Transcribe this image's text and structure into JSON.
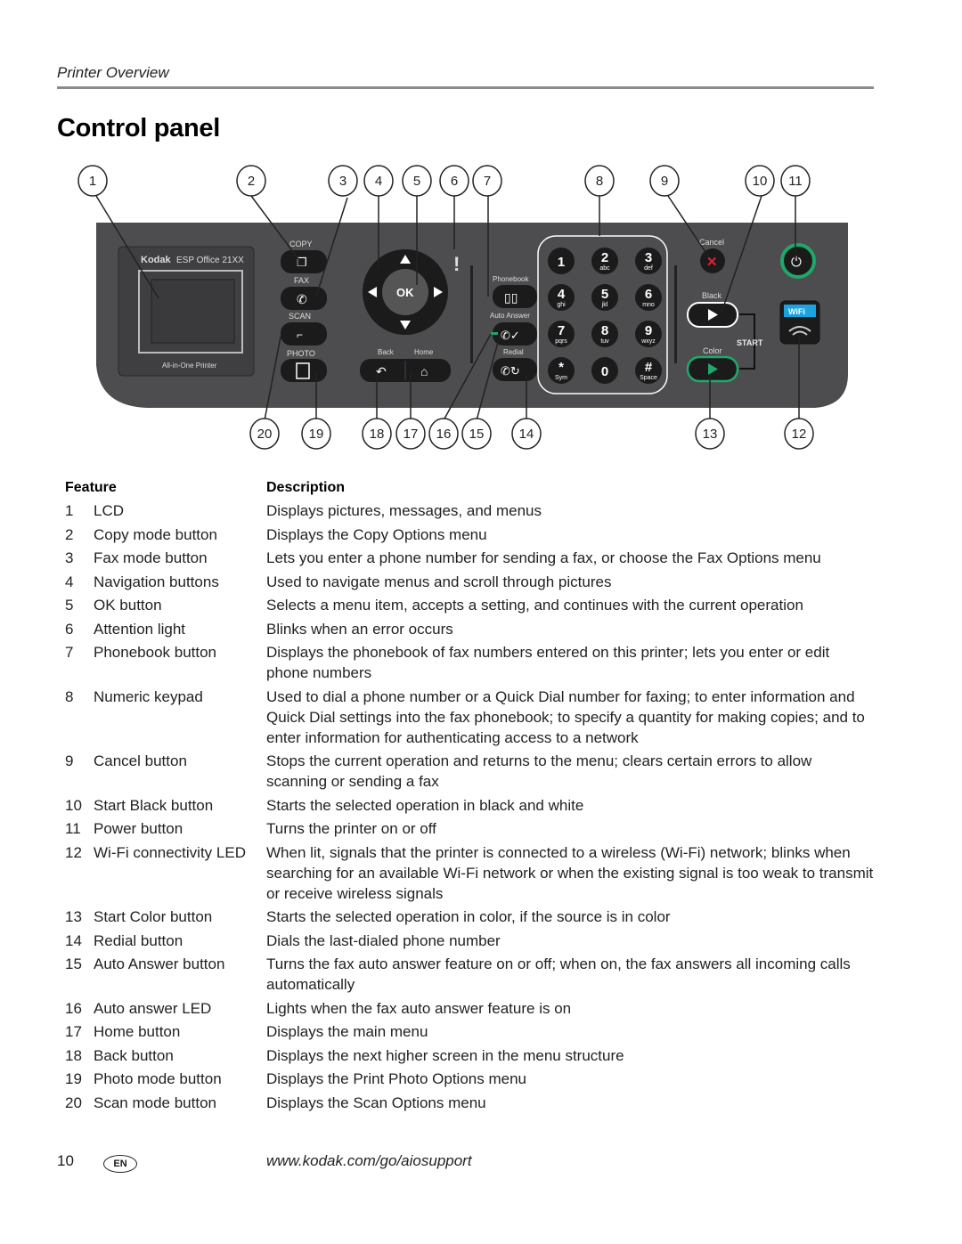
{
  "header": {
    "section": "Printer Overview",
    "title": "Control panel"
  },
  "diagram": {
    "brand": "Kodak",
    "model": "ESP Office 21XX",
    "subtitle": "All-in-One Printer",
    "labels": {
      "copy": "COPY",
      "fax": "FAX",
      "scan": "SCAN",
      "photo": "PHOTO",
      "ok": "OK",
      "back": "Back",
      "home": "Home",
      "phonebook": "Phonebook",
      "auto_answer": "Auto Answer",
      "redial": "Redial",
      "cancel": "Cancel",
      "black": "Black",
      "color": "Color",
      "start": "START",
      "wifi": "WiFi",
      "attention": "!"
    },
    "keypad": [
      {
        "digit": "1",
        "sub": ""
      },
      {
        "digit": "2",
        "sub": "abc"
      },
      {
        "digit": "3",
        "sub": "def"
      },
      {
        "digit": "4",
        "sub": "ghi"
      },
      {
        "digit": "5",
        "sub": "jkl"
      },
      {
        "digit": "6",
        "sub": "mno"
      },
      {
        "digit": "7",
        "sub": "pqrs"
      },
      {
        "digit": "8",
        "sub": "tuv"
      },
      {
        "digit": "9",
        "sub": "wxyz"
      },
      {
        "digit": "*",
        "sub": "Sym"
      },
      {
        "digit": "0",
        "sub": ""
      },
      {
        "digit": "#",
        "sub": "Space"
      }
    ],
    "callouts_top": [
      "1",
      "2",
      "3",
      "4",
      "5",
      "6",
      "7",
      "8",
      "9",
      "10",
      "11"
    ],
    "callouts_bottom": [
      "20",
      "19",
      "18",
      "17",
      "16",
      "15",
      "14",
      "13",
      "12"
    ],
    "colors": {
      "panel": "#4d4d4f",
      "button": "#1b1b1b",
      "accent_green": "#1fa86a",
      "cancel_red": "#e0203a",
      "wifi_blue": "#1aa3e0"
    }
  },
  "table": {
    "headers": {
      "feature": "Feature",
      "description": "Description"
    },
    "rows": [
      {
        "num": "1",
        "feature": "LCD",
        "description": "Displays pictures, messages, and menus"
      },
      {
        "num": "2",
        "feature": "Copy mode button",
        "description": "Displays the Copy Options menu"
      },
      {
        "num": "3",
        "feature": "Fax mode button",
        "description": "Lets you enter a phone number for sending a fax, or choose the Fax Options menu"
      },
      {
        "num": "4",
        "feature": "Navigation buttons",
        "description": "Used to navigate menus and scroll through pictures"
      },
      {
        "num": "5",
        "feature": "OK button",
        "description": "Selects a menu item, accepts a setting, and continues with the current operation"
      },
      {
        "num": "6",
        "feature": "Attention light",
        "description": "Blinks when an error occurs"
      },
      {
        "num": "7",
        "feature": "Phonebook button",
        "description": "Displays the phonebook of fax numbers entered on this printer; lets you enter or edit phone numbers"
      },
      {
        "num": "8",
        "feature": "Numeric keypad",
        "description": "Used to dial a phone number or a Quick Dial number for faxing; to enter information and Quick Dial settings into the fax phonebook; to specify a quantity for making copies; and to enter information for authenticating access to a network"
      },
      {
        "num": "9",
        "feature": "Cancel button",
        "description": "Stops the current operation and returns to the menu; clears certain errors to allow scanning or sending a fax"
      },
      {
        "num": "10",
        "feature": "Start Black button",
        "description": "Starts the selected operation in black and white"
      },
      {
        "num": "11",
        "feature": "Power button",
        "description": "Turns the printer on or off"
      },
      {
        "num": "12",
        "feature": "Wi-Fi connectivity LED",
        "description": "When lit, signals that the printer is connected to a wireless (Wi-Fi) network; blinks when searching for an available Wi-Fi network or when the existing signal is too weak to transmit or receive wireless signals"
      },
      {
        "num": "13",
        "feature": "Start Color button",
        "description": "Starts the selected operation in color, if the source is in color"
      },
      {
        "num": "14",
        "feature": "Redial button",
        "description": "Dials the last-dialed phone number"
      },
      {
        "num": "15",
        "feature": "Auto Answer button",
        "description": "Turns the fax auto answer feature on or off; when on, the fax answers all incoming calls automatically"
      },
      {
        "num": "16",
        "feature": "Auto answer LED",
        "description": "Lights when the fax auto answer feature is on"
      },
      {
        "num": "17",
        "feature": "Home button",
        "description": "Displays the main menu"
      },
      {
        "num": "18",
        "feature": "Back button",
        "description": "Displays the next higher screen in the menu structure"
      },
      {
        "num": "19",
        "feature": "Photo mode button",
        "description": "Displays the Print Photo Options menu"
      },
      {
        "num": "20",
        "feature": "Scan mode button",
        "description": "Displays the Scan Options menu"
      }
    ]
  },
  "footer": {
    "page_number": "10",
    "language_badge": "EN",
    "url": "www.kodak.com/go/aiosupport"
  }
}
